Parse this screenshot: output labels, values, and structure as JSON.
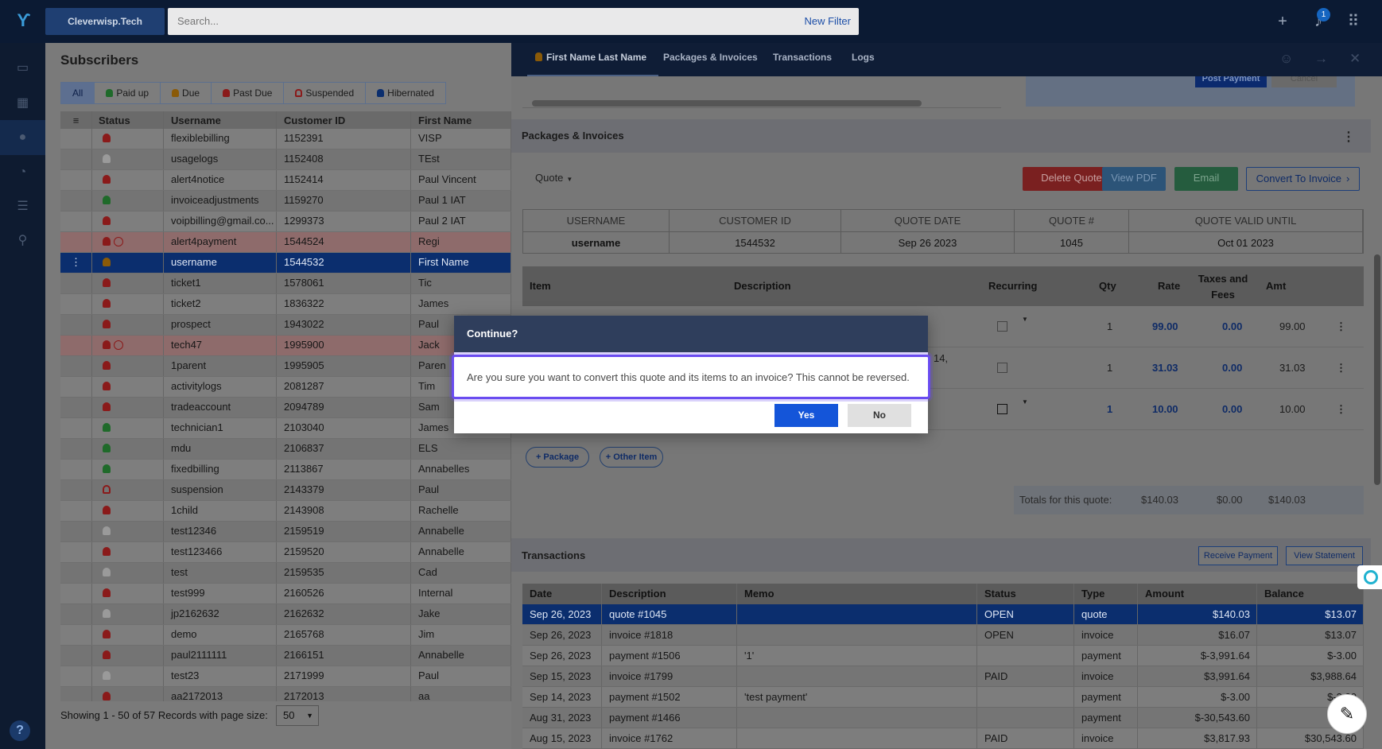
{
  "app": {
    "org_name": "Cleverwisp.Tech",
    "search_placeholder": "Search...",
    "new_filter": "New Filter",
    "notification_count": "1",
    "help": "?"
  },
  "icons": {
    "logo": "feather-logo",
    "add": "plus-icon",
    "bell": "bell-icon",
    "apps": "grid-icon"
  },
  "sidebar": {
    "items": [
      "dashboard-icon",
      "tiles-icon",
      "person-icon",
      "support-icon",
      "list-icon",
      "map-pin-icon"
    ]
  },
  "subscribers": {
    "title": "Subscribers",
    "filters": [
      "All",
      "Paid up",
      "Due",
      "Past Due",
      "Suspended",
      "Hibernated"
    ],
    "columns": [
      "Status",
      "Username",
      "Customer ID",
      "First Name"
    ],
    "rows": [
      {
        "username": "flexiblebilling",
        "customer_id": "1152391",
        "first_name": "VISP",
        "status": "red"
      },
      {
        "username": "usagelogs",
        "customer_id": "1152408",
        "first_name": "TEst",
        "status": "grey"
      },
      {
        "username": "alert4notice",
        "customer_id": "1152414",
        "first_name": "Paul Vincent",
        "status": "red"
      },
      {
        "username": "invoiceadjustments",
        "customer_id": "1159270",
        "first_name": "Paul 1 IAT",
        "status": "green"
      },
      {
        "username": "voipbilling@gmail.co...",
        "customer_id": "1299373",
        "first_name": "Paul 2 IAT",
        "status": "red"
      },
      {
        "username": "alert4payment",
        "customer_id": "1544524",
        "first_name": "Regi",
        "status": "red-alert"
      },
      {
        "username": "username",
        "customer_id": "1544532",
        "first_name": "First Name",
        "status": "orange"
      },
      {
        "username": "ticket1",
        "customer_id": "1578061",
        "first_name": "Tic",
        "status": "red"
      },
      {
        "username": "ticket2",
        "customer_id": "1836322",
        "first_name": "James",
        "status": "red"
      },
      {
        "username": "prospect",
        "customer_id": "1943022",
        "first_name": "Paul",
        "status": "red"
      },
      {
        "username": "tech47",
        "customer_id": "1995900",
        "first_name": "Jack",
        "status": "red-alert"
      },
      {
        "username": "1parent",
        "customer_id": "1995905",
        "first_name": "Paren",
        "status": "red"
      },
      {
        "username": "activitylogs",
        "customer_id": "2081287",
        "first_name": "Tim",
        "status": "red"
      },
      {
        "username": "tradeaccount",
        "customer_id": "2094789",
        "first_name": "Sam",
        "status": "red"
      },
      {
        "username": "technician1",
        "customer_id": "2103040",
        "first_name": "James",
        "status": "green"
      },
      {
        "username": "mdu",
        "customer_id": "2106837",
        "first_name": "ELS",
        "status": "green"
      },
      {
        "username": "fixedbilling",
        "customer_id": "2113867",
        "first_name": "Annabelles",
        "status": "green"
      },
      {
        "username": "suspension",
        "customer_id": "2143379",
        "first_name": "Paul",
        "status": "outline"
      },
      {
        "username": "1child",
        "customer_id": "2143908",
        "first_name": "Rachelle",
        "status": "red"
      },
      {
        "username": "test12346",
        "customer_id": "2159519",
        "first_name": "Annabelle",
        "status": "grey"
      },
      {
        "username": "test123466",
        "customer_id": "2159520",
        "first_name": "Annabelle",
        "status": "red"
      },
      {
        "username": "test",
        "customer_id": "2159535",
        "first_name": "Cad",
        "status": "grey"
      },
      {
        "username": "test999",
        "customer_id": "2160526",
        "first_name": "Internal",
        "status": "red"
      },
      {
        "username": "jp2162632",
        "customer_id": "2162632",
        "first_name": "Jake",
        "status": "grey"
      },
      {
        "username": "demo",
        "customer_id": "2165768",
        "first_name": "Jim",
        "status": "red"
      },
      {
        "username": "paul2111111",
        "customer_id": "2166151",
        "first_name": "Annabelle",
        "status": "red"
      },
      {
        "username": "test23",
        "customer_id": "2171999",
        "first_name": "Paul",
        "status": "grey"
      },
      {
        "username": "aa2172013",
        "customer_id": "2172013",
        "first_name": "aa",
        "status": "red"
      }
    ],
    "paging_text": "Showing 1 - 50 of 57 Records with page size:",
    "page_size": "50"
  },
  "detail": {
    "tabs": [
      "First Name Last Name",
      "Packages & Invoices",
      "Transactions",
      "Logs"
    ],
    "post_payment": "Post Payment",
    "cancel": "Cancel",
    "packages_title": "Packages & Invoices",
    "quote_dropdown": "Quote",
    "buttons": {
      "delete": "Delete Quote",
      "pdf": "View PDF",
      "email": "Email",
      "convert": "Convert To Invoice"
    },
    "summary_headers": [
      "USERNAME",
      "CUSTOMER ID",
      "QUOTE DATE",
      "QUOTE #",
      "QUOTE VALID UNTIL"
    ],
    "summary_values": [
      "username",
      "1544532",
      "Sep 26 2023",
      "1045",
      "Oct 01 2023"
    ],
    "item_headers": {
      "item": "Item",
      "description": "Description",
      "recurring": "Recurring",
      "qty": "Qty",
      "rate": "Rate",
      "taxes": "Taxes and Fees",
      "amt": "Amt"
    },
    "items": [
      {
        "qty": "1",
        "rate": "99.00",
        "tax": "0.00",
        "amt": "99.00",
        "desc": ""
      },
      {
        "qty": "1",
        "rate": "31.03",
        "tax": "0.00",
        "amt": "31.03",
        "desc": "14,"
      },
      {
        "qty": "1",
        "rate": "10.00",
        "tax": "0.00",
        "amt": "10.00",
        "desc": ""
      }
    ],
    "add_package": "+ Package",
    "add_other": "+ Other Item",
    "totals_label": "Totals for this quote:",
    "totals": [
      "$140.03",
      "$0.00",
      "$140.03"
    ],
    "transactions_title": "Transactions",
    "receive_payment": "Receive Payment",
    "view_statement": "View Statement",
    "tx_headers": [
      "Date",
      "Description",
      "Memo",
      "Status",
      "Type",
      "Amount",
      "Balance"
    ],
    "transactions": [
      {
        "date": "Sep 26, 2023",
        "desc": "quote #1045",
        "memo": "",
        "status": "OPEN",
        "type": "quote",
        "amount": "$140.03",
        "balance": "$13.07"
      },
      {
        "date": "Sep 26, 2023",
        "desc": "invoice #1818",
        "memo": "",
        "status": "OPEN",
        "type": "invoice",
        "amount": "$16.07",
        "balance": "$13.07"
      },
      {
        "date": "Sep 26, 2023",
        "desc": "payment #1506",
        "memo": "'1'",
        "status": "",
        "type": "payment",
        "amount": "$-3,991.64",
        "balance": "$-3.00"
      },
      {
        "date": "Sep 15, 2023",
        "desc": "invoice #1799",
        "memo": "",
        "status": "PAID",
        "type": "invoice",
        "amount": "$3,991.64",
        "balance": "$3,988.64"
      },
      {
        "date": "Sep 14, 2023",
        "desc": "payment #1502",
        "memo": "'test payment'",
        "status": "",
        "type": "payment",
        "amount": "$-3.00",
        "balance": "$-3.00"
      },
      {
        "date": "Aug 31, 2023",
        "desc": "payment #1466",
        "memo": "",
        "status": "",
        "type": "payment",
        "amount": "$-30,543.60",
        "balance": ""
      },
      {
        "date": "Aug 15, 2023",
        "desc": "invoice #1762",
        "memo": "",
        "status": "PAID",
        "type": "invoice",
        "amount": "$3,817.93",
        "balance": "$30,543.60"
      }
    ]
  },
  "modal": {
    "title": "Continue?",
    "message": "Are you sure you want to convert this quote and its items to an invoice? This cannot be reversed.",
    "yes": "Yes",
    "no": "No"
  }
}
